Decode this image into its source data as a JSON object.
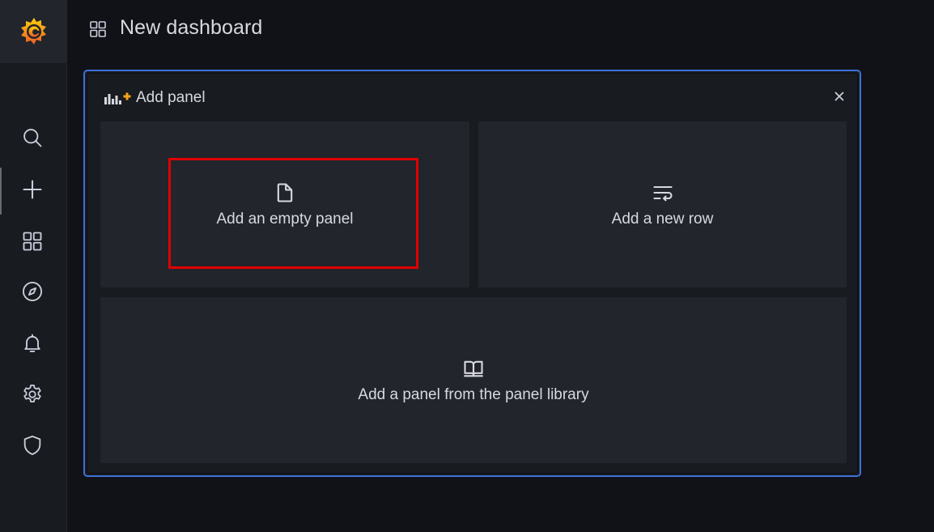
{
  "header": {
    "title": "New dashboard",
    "icon": "apps-icon"
  },
  "sidebar": {
    "logo": "grafana-logo",
    "items": [
      {
        "name": "search",
        "icon": "search-icon"
      },
      {
        "name": "create",
        "icon": "plus-icon"
      },
      {
        "name": "dashboards",
        "icon": "apps-icon"
      },
      {
        "name": "explore",
        "icon": "compass-icon"
      },
      {
        "name": "alerting",
        "icon": "bell-icon"
      },
      {
        "name": "configuration",
        "icon": "gear-icon"
      },
      {
        "name": "server-admin",
        "icon": "shield-icon"
      }
    ]
  },
  "add_panel": {
    "title": "Add panel",
    "close_icon": "close-icon",
    "options": [
      {
        "label": "Add an empty panel",
        "icon": "file-blank-icon"
      },
      {
        "label": "Add a new row",
        "icon": "wrap-text-icon"
      },
      {
        "label": "Add a panel from the panel library",
        "icon": "book-open-icon"
      }
    ]
  },
  "colors": {
    "background": "#111217",
    "sidebar": "#181b1f",
    "panel_border": "#3d71d9",
    "option_bg": "#22252b",
    "highlight": "#e00000",
    "logo_orange": "#f46800"
  }
}
